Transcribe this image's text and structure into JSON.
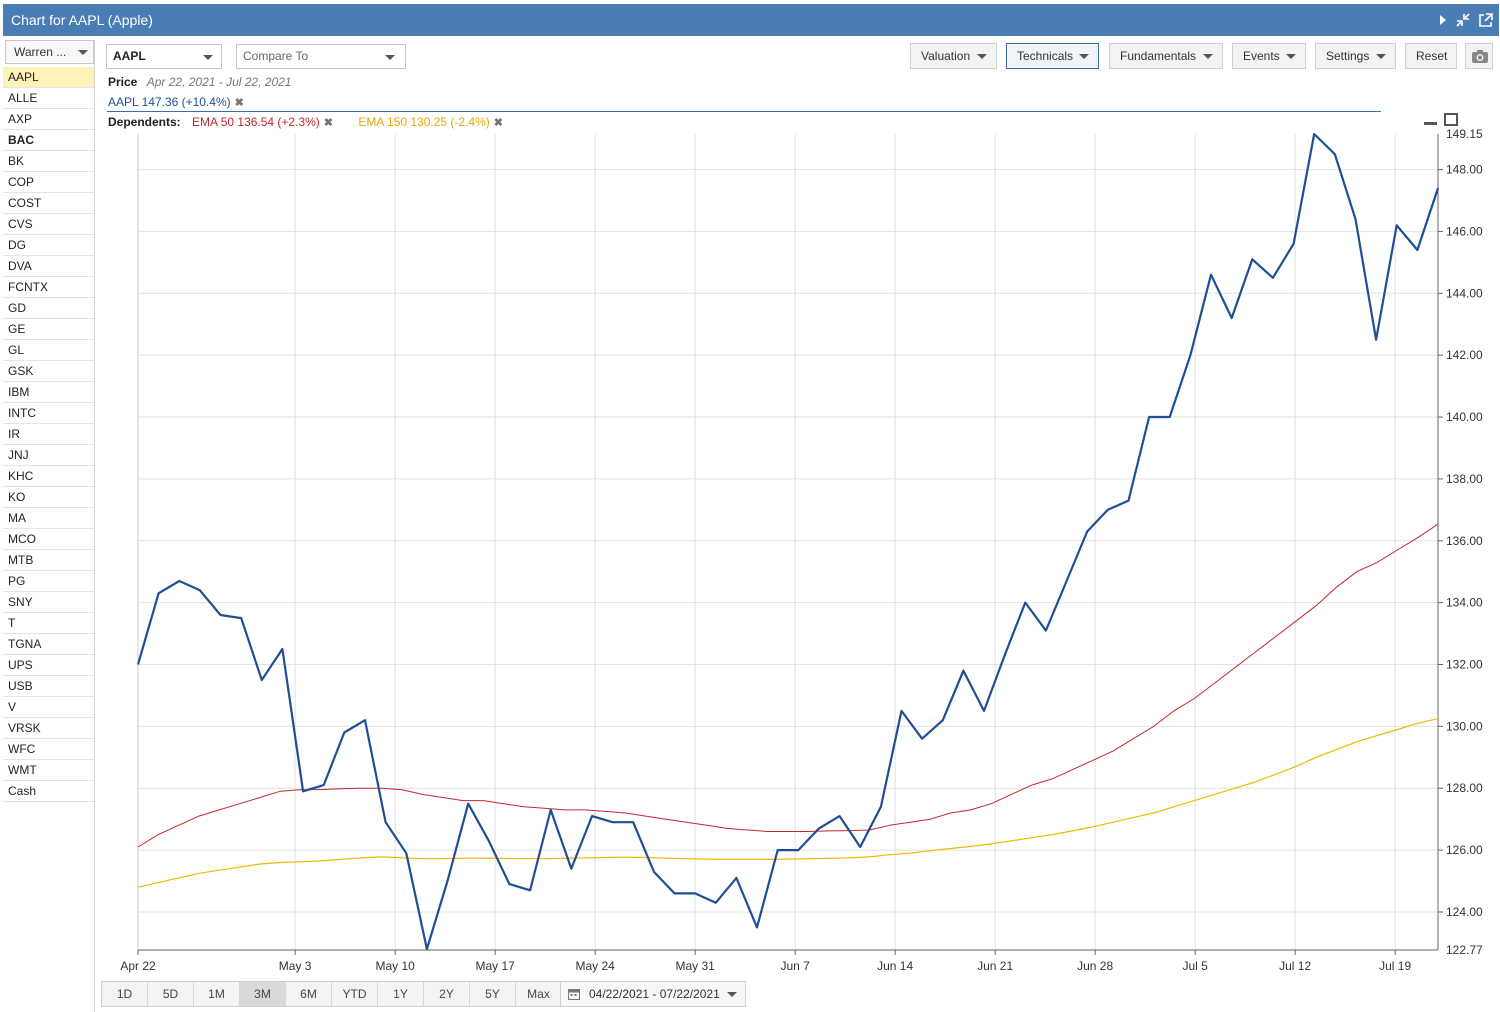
{
  "window": {
    "title": "Chart for AAPL (Apple)"
  },
  "sidebar": {
    "portfolio": "Warren ...",
    "symbols": [
      "AAPL",
      "ALLE",
      "AXP",
      "BAC",
      "BK",
      "COP",
      "COST",
      "CVS",
      "DG",
      "DVA",
      "FCNTX",
      "GD",
      "GE",
      "GL",
      "GSK",
      "IBM",
      "INTC",
      "IR",
      "JNJ",
      "KHC",
      "KO",
      "MA",
      "MCO",
      "MTB",
      "PG",
      "SNY",
      "T",
      "TGNA",
      "UPS",
      "USB",
      "V",
      "VRSK",
      "WFC",
      "WMT",
      "Cash"
    ],
    "selected": "AAPL"
  },
  "toolbar": {
    "symbol": "AAPL",
    "compare_placeholder": "Compare To",
    "valuation": "Valuation",
    "technicals": "Technicals",
    "fundamentals": "Fundamentals",
    "events": "Events",
    "settings": "Settings",
    "reset": "Reset"
  },
  "legend": {
    "price_label": "Price",
    "date_range": "Apr 22, 2021 - Jul 22, 2021",
    "series_label": "AAPL 147.36 (+10.4%)",
    "dependents_label": "Dependents:",
    "ema50_label": "EMA 50 136.54 (+2.3%)",
    "ema150_label": "EMA 150 130.25 (-2.4%)"
  },
  "colors": {
    "aapl": "#1f4e96",
    "ema50": "#c0282d",
    "ema150": "#f2b705",
    "header": "#4a7db4"
  },
  "range_buttons": [
    "1D",
    "5D",
    "1M",
    "3M",
    "6M",
    "YTD",
    "1Y",
    "2Y",
    "5Y",
    "Max"
  ],
  "range_selected": "3M",
  "date_picker": "04/22/2021 - 07/22/2021",
  "chart_data": {
    "type": "line",
    "x_dates": [
      "2021-04-22",
      "2021-04-23",
      "2021-04-26",
      "2021-04-27",
      "2021-04-28",
      "2021-04-29",
      "2021-04-30",
      "2021-05-03",
      "2021-05-04",
      "2021-05-05",
      "2021-05-06",
      "2021-05-07",
      "2021-05-10",
      "2021-05-11",
      "2021-05-12",
      "2021-05-13",
      "2021-05-14",
      "2021-05-17",
      "2021-05-18",
      "2021-05-19",
      "2021-05-20",
      "2021-05-21",
      "2021-05-24",
      "2021-05-25",
      "2021-05-26",
      "2021-05-27",
      "2021-05-28",
      "2021-06-01",
      "2021-06-02",
      "2021-06-03",
      "2021-06-04",
      "2021-06-07",
      "2021-06-08",
      "2021-06-09",
      "2021-06-10",
      "2021-06-11",
      "2021-06-14",
      "2021-06-15",
      "2021-06-16",
      "2021-06-17",
      "2021-06-18",
      "2021-06-21",
      "2021-06-22",
      "2021-06-25",
      "2021-06-28",
      "2021-06-29",
      "2021-06-30",
      "2021-07-01",
      "2021-07-02",
      "2021-07-06",
      "2021-07-07",
      "2021-07-08",
      "2021-07-09",
      "2021-07-12",
      "2021-07-13",
      "2021-07-14",
      "2021-07-15",
      "2021-07-16",
      "2021-07-19",
      "2021-07-20",
      "2021-07-21",
      "2021-07-22"
    ],
    "x_ticks": [
      {
        "date": "2021-04-22",
        "label": "Apr 22"
      },
      {
        "date": "2021-05-03",
        "label": "May 3"
      },
      {
        "date": "2021-05-10",
        "label": "May 10"
      },
      {
        "date": "2021-05-17",
        "label": "May 17"
      },
      {
        "date": "2021-05-24",
        "label": "May 24"
      },
      {
        "date": "2021-05-31",
        "label": "May 31"
      },
      {
        "date": "2021-06-07",
        "label": "Jun 7"
      },
      {
        "date": "2021-06-14",
        "label": "Jun 14"
      },
      {
        "date": "2021-06-21",
        "label": "Jun 21"
      },
      {
        "date": "2021-06-28",
        "label": "Jun 28"
      },
      {
        "date": "2021-07-05",
        "label": "Jul 5"
      },
      {
        "date": "2021-07-12",
        "label": "Jul 12"
      },
      {
        "date": "2021-07-19",
        "label": "Jul 19"
      }
    ],
    "x_range": [
      "2021-04-22",
      "2021-07-22"
    ],
    "y_ticks": [
      124,
      126,
      128,
      130,
      132,
      134,
      136,
      138,
      140,
      142,
      144,
      146,
      148
    ],
    "y_tick_labels": [
      "124.00",
      "126.00",
      "128.00",
      "130.00",
      "132.00",
      "134.00",
      "136.00",
      "138.00",
      "140.00",
      "142.00",
      "144.00",
      "146.00",
      "148.00"
    ],
    "y_min_label": "122.77",
    "y_max_label": "149.15",
    "ylim": [
      122.77,
      149.15
    ],
    "grid": true,
    "series": [
      {
        "name": "AAPL",
        "values": [
          132.0,
          134.3,
          134.7,
          134.4,
          133.6,
          133.5,
          131.5,
          132.5,
          127.9,
          128.1,
          129.8,
          130.2,
          126.9,
          125.9,
          122.8,
          125.0,
          127.5,
          126.3,
          124.9,
          124.7,
          127.3,
          125.4,
          127.1,
          126.9,
          126.9,
          125.3,
          124.6,
          124.6,
          124.3,
          125.1,
          123.5,
          126.0,
          126.0,
          126.7,
          127.1,
          126.1,
          127.4,
          130.5,
          129.6,
          130.2,
          131.8,
          130.5,
          132.3,
          134.0,
          133.1,
          134.7,
          136.3,
          137.0,
          137.3,
          140.0,
          140.0,
          142.0,
          144.6,
          143.2,
          145.1,
          144.5,
          145.6,
          149.15,
          148.5,
          146.4,
          142.5,
          146.2,
          145.4,
          147.4
        ]
      },
      {
        "name": "EMA 50",
        "values": [
          126.1,
          126.5,
          126.8,
          127.1,
          127.3,
          127.5,
          127.7,
          127.9,
          127.95,
          127.96,
          127.98,
          128.0,
          128.0,
          127.95,
          127.8,
          127.7,
          127.6,
          127.6,
          127.5,
          127.4,
          127.35,
          127.3,
          127.3,
          127.25,
          127.2,
          127.1,
          127.0,
          126.9,
          126.8,
          126.7,
          126.65,
          126.6,
          126.6,
          126.6,
          126.62,
          126.63,
          126.65,
          126.8,
          126.9,
          127.0,
          127.2,
          127.3,
          127.5,
          127.8,
          128.1,
          128.3,
          128.6,
          128.9,
          129.2,
          129.6,
          130.0,
          130.5,
          130.9,
          131.4,
          131.9,
          132.4,
          132.9,
          133.4,
          133.9,
          134.5,
          135.0,
          135.3,
          135.7,
          136.1,
          136.54
        ]
      },
      {
        "name": "EMA 150",
        "values": [
          124.8,
          124.95,
          125.1,
          125.25,
          125.35,
          125.45,
          125.55,
          125.6,
          125.62,
          125.65,
          125.7,
          125.75,
          125.78,
          125.75,
          125.72,
          125.72,
          125.74,
          125.74,
          125.73,
          125.72,
          125.72,
          125.73,
          125.75,
          125.76,
          125.77,
          125.76,
          125.74,
          125.72,
          125.71,
          125.7,
          125.7,
          125.7,
          125.71,
          125.72,
          125.73,
          125.75,
          125.78,
          125.85,
          125.9,
          125.98,
          126.05,
          126.12,
          126.2,
          126.3,
          126.4,
          126.5,
          126.62,
          126.75,
          126.9,
          127.05,
          127.2,
          127.4,
          127.6,
          127.8,
          128.0,
          128.2,
          128.45,
          128.7,
          129.0,
          129.25,
          129.5,
          129.7,
          129.9,
          130.1,
          130.25
        ]
      }
    ]
  }
}
